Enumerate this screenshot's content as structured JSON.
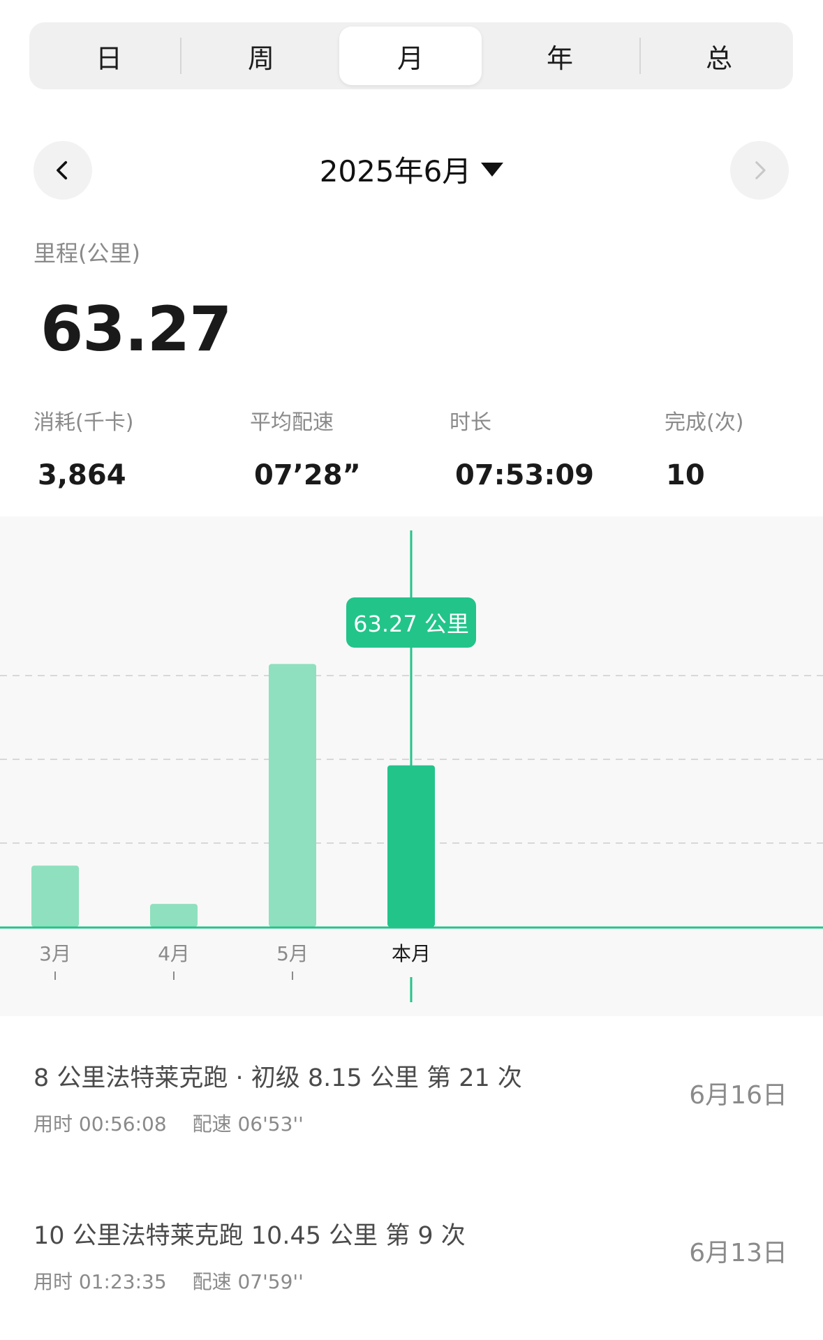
{
  "tabs": [
    {
      "label": "日",
      "active": false
    },
    {
      "label": "周",
      "active": false
    },
    {
      "label": "月",
      "active": true
    },
    {
      "label": "年",
      "active": false
    },
    {
      "label": "总",
      "active": false
    }
  ],
  "date_nav": {
    "title": "2025年6月",
    "prev_icon": "chevron-left-icon",
    "next_icon": "chevron-right-icon",
    "next_disabled": true
  },
  "distance": {
    "label": "里程(公里)",
    "value": "63.27"
  },
  "stats": [
    {
      "label": "消耗(千卡)",
      "value": "3,864"
    },
    {
      "label": "平均配速",
      "value": "07’28”"
    },
    {
      "label": "时长",
      "value": "07:53:09"
    },
    {
      "label": "完成(次)",
      "value": "10"
    }
  ],
  "tooltip": "63.27 公里",
  "chart_data": {
    "type": "bar",
    "categories": [
      "3月",
      "4月",
      "5月",
      "本月"
    ],
    "values": [
      24,
      9,
      103,
      63.27
    ],
    "highlight_index": 3,
    "ylim": [
      0,
      140
    ],
    "grid": true,
    "colors": {
      "bar": "#8fe0bf",
      "highlight": "#22c48a",
      "axis": "#22c48a",
      "grid": "#d8d8d8"
    }
  },
  "activities": [
    {
      "title": "8 公里法特莱克跑 · 初级  8.15 公里  第 21 次",
      "duration": "用时 00:56:08",
      "pace": "配速 06'53''",
      "date": "6月16日"
    },
    {
      "title": "10 公里法特莱克跑  10.45 公里  第 9 次",
      "duration": "用时 01:23:35",
      "pace": "配速 07'59''",
      "date": "6月13日"
    }
  ]
}
